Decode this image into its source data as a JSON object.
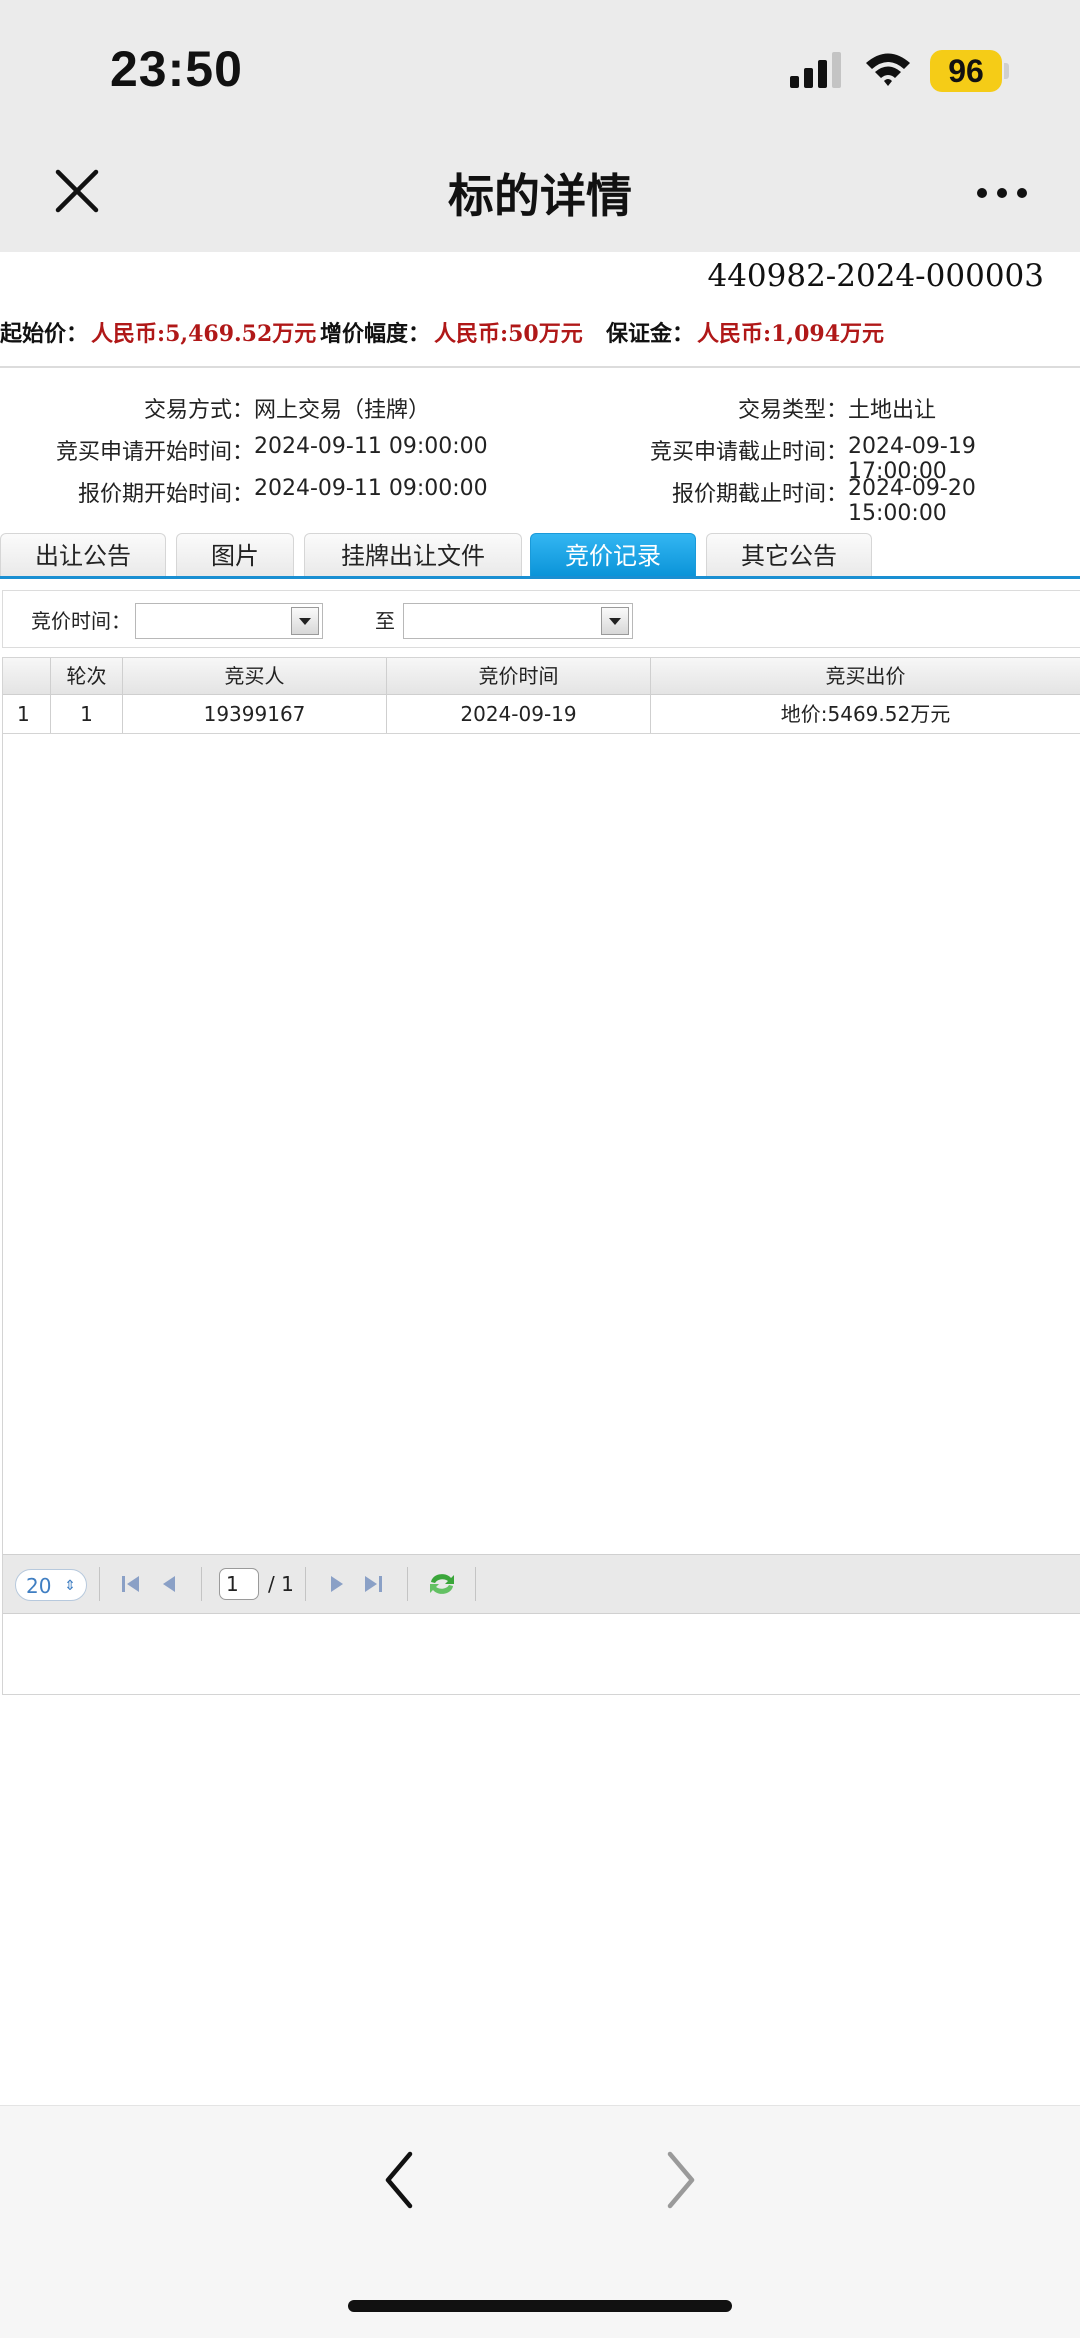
{
  "status_bar": {
    "time": "23:50",
    "battery": "96"
  },
  "header": {
    "title": "标的详情"
  },
  "lot_number": "440982-2024-000003",
  "price": {
    "start_label": "起始价：",
    "start_value": "人民币:5,469.52万元",
    "step_label": "增价幅度：",
    "step_value": "人民币:50万元",
    "deposit_label": "保证金：",
    "deposit_value": "人民币:1,094万元"
  },
  "info": {
    "trade_method_label": "交易方式：",
    "trade_method": "网上交易（挂牌）",
    "trade_type_label": "交易类型：",
    "trade_type": "土地出让",
    "apply_start_label": "竞买申请开始时间：",
    "apply_start": "2024-09-11 09:00:00",
    "apply_end_label": "竞买申请截止时间：",
    "apply_end": "2024-09-19 17:00:00",
    "quote_start_label": "报价期开始时间：",
    "quote_start": "2024-09-11 09:00:00",
    "quote_end_label": "报价期截止时间：",
    "quote_end": "2024-09-20 15:00:00"
  },
  "tabs": [
    {
      "label": "出让公告"
    },
    {
      "label": "图片"
    },
    {
      "label": "挂牌出让文件"
    },
    {
      "label": "竞价记录"
    },
    {
      "label": "其它公告"
    }
  ],
  "active_tab": "竞价记录",
  "filter": {
    "label": "竞价时间：",
    "to": "至",
    "from_value": "",
    "to_value": ""
  },
  "grid": {
    "headers": [
      "",
      "轮次",
      "竞买人",
      "竞价时间",
      "竞买出价"
    ],
    "rows": [
      [
        "1",
        "1",
        "19399167",
        "2024-09-19",
        "地价:5469.52万元"
      ]
    ]
  },
  "pager": {
    "page_size": "20",
    "page": "1",
    "total": "/ 1"
  },
  "colors": {
    "accent": "#0a93d8",
    "price_red": "#b01818",
    "battery": "#f5cc17"
  },
  "icons": {
    "close": "close-icon",
    "more": "more-icon",
    "first": "first-page-icon",
    "prev": "prev-page-icon",
    "next": "next-page-icon",
    "last": "last-page-icon",
    "refresh": "refresh-icon",
    "back": "back-icon",
    "forward": "forward-icon"
  }
}
